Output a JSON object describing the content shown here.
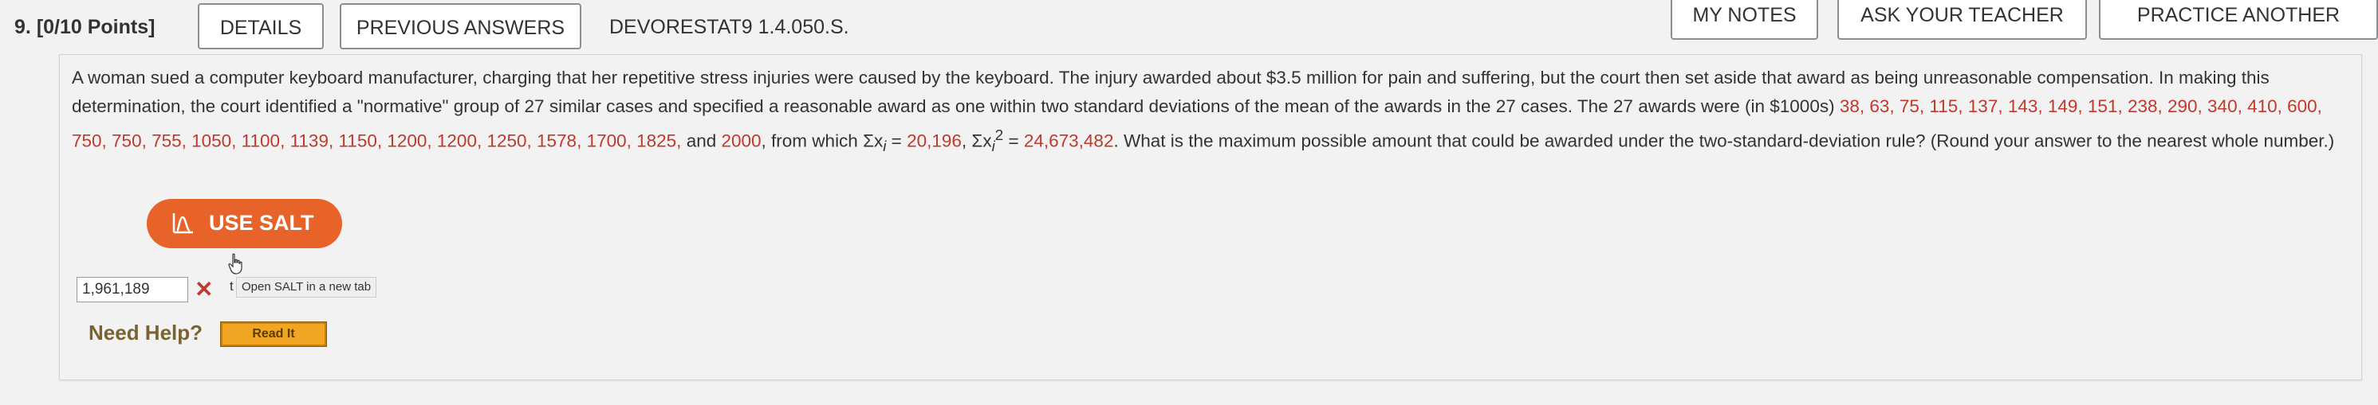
{
  "header": {
    "question_number": "9.",
    "points": "[0/10 Points]",
    "details_label": "DETAILS",
    "previous_answers_label": "PREVIOUS ANSWERS",
    "assignment_code": "DEVORESTAT9 1.4.050.S.",
    "my_notes_label": "MY NOTES",
    "ask_teacher_label": "ASK YOUR TEACHER",
    "practice_another_label": "PRACTICE ANOTHER"
  },
  "question": {
    "intro": "A woman sued a computer keyboard manufacturer, charging that her repetitive stress injuries were caused by the keyboard. The injury awarded about $3.5 million for pain and suffering, but the court then set aside that award as being unreasonable compensation. In making this determination, the court identified a \"normative\" group of 27 similar cases and specified a reasonable award as one within two standard deviations of the mean of the awards in the 27 cases. The 27 awards were (in $1000s) ",
    "awards_list": "38, 63, 75, 115, 137, 143, 149, 151, 238, 290, 340, 410, 600, 750, 750, 755, 1050, 1100, 1139, 1150, 1200, 1200, 1250, 1578, 1700, 1825,",
    "and_word": " and ",
    "last_award": "2000",
    "from_which": ", from which Σx",
    "sub_i": "i",
    "equals1": " = ",
    "sum_x": "20,196",
    "sigma_x2": ", Σx",
    "sub_i2": "i",
    "sup_2": "2",
    "equals2": " = ",
    "sum_x2": "24,673,482",
    "outro": ". What is the maximum possible amount that could be awarded under the two-standard-deviation rule? (Round your answer to the nearest whole number.)"
  },
  "salt": {
    "label": "USE SALT",
    "tooltip": "Open SALT in a new tab",
    "tooltip_prefix": "t"
  },
  "answer": {
    "value": "1,961,189"
  },
  "help": {
    "label": "Need Help?",
    "read_it_label": "Read It"
  },
  "colors": {
    "accent_orange": "#e8632a",
    "error_red": "#c0392b",
    "read_it_gold": "#f0a623"
  },
  "icons": {
    "salt": "chart-icon",
    "incorrect": "x-mark-icon",
    "cursor": "hand-cursor-icon"
  }
}
